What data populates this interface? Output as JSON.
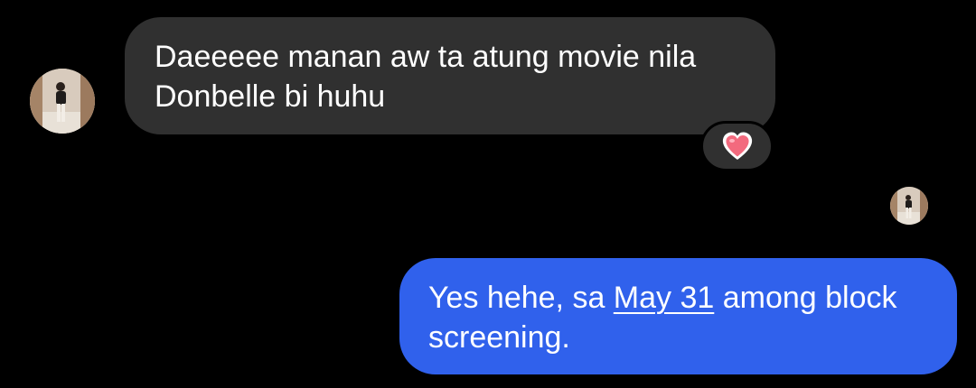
{
  "conversation": {
    "incoming": {
      "sender_avatar_icon": "contact-avatar",
      "lines": [
        "Daeeeee manan aw ta atung movie nila",
        "Donbelle bi huhu"
      ],
      "bubble_color": "#303030",
      "reaction": {
        "icon": "heart-emoji",
        "emoji": "❤️",
        "color": "#f36a7e"
      }
    },
    "read_receipt": {
      "icon": "seen-by-avatar"
    },
    "outgoing": {
      "line1_before_link": "Yes hehe, sa ",
      "link_text": "May 31",
      "line1_after_link": " among block",
      "line2": "screening.",
      "bubble_color": "#3061ec"
    }
  }
}
